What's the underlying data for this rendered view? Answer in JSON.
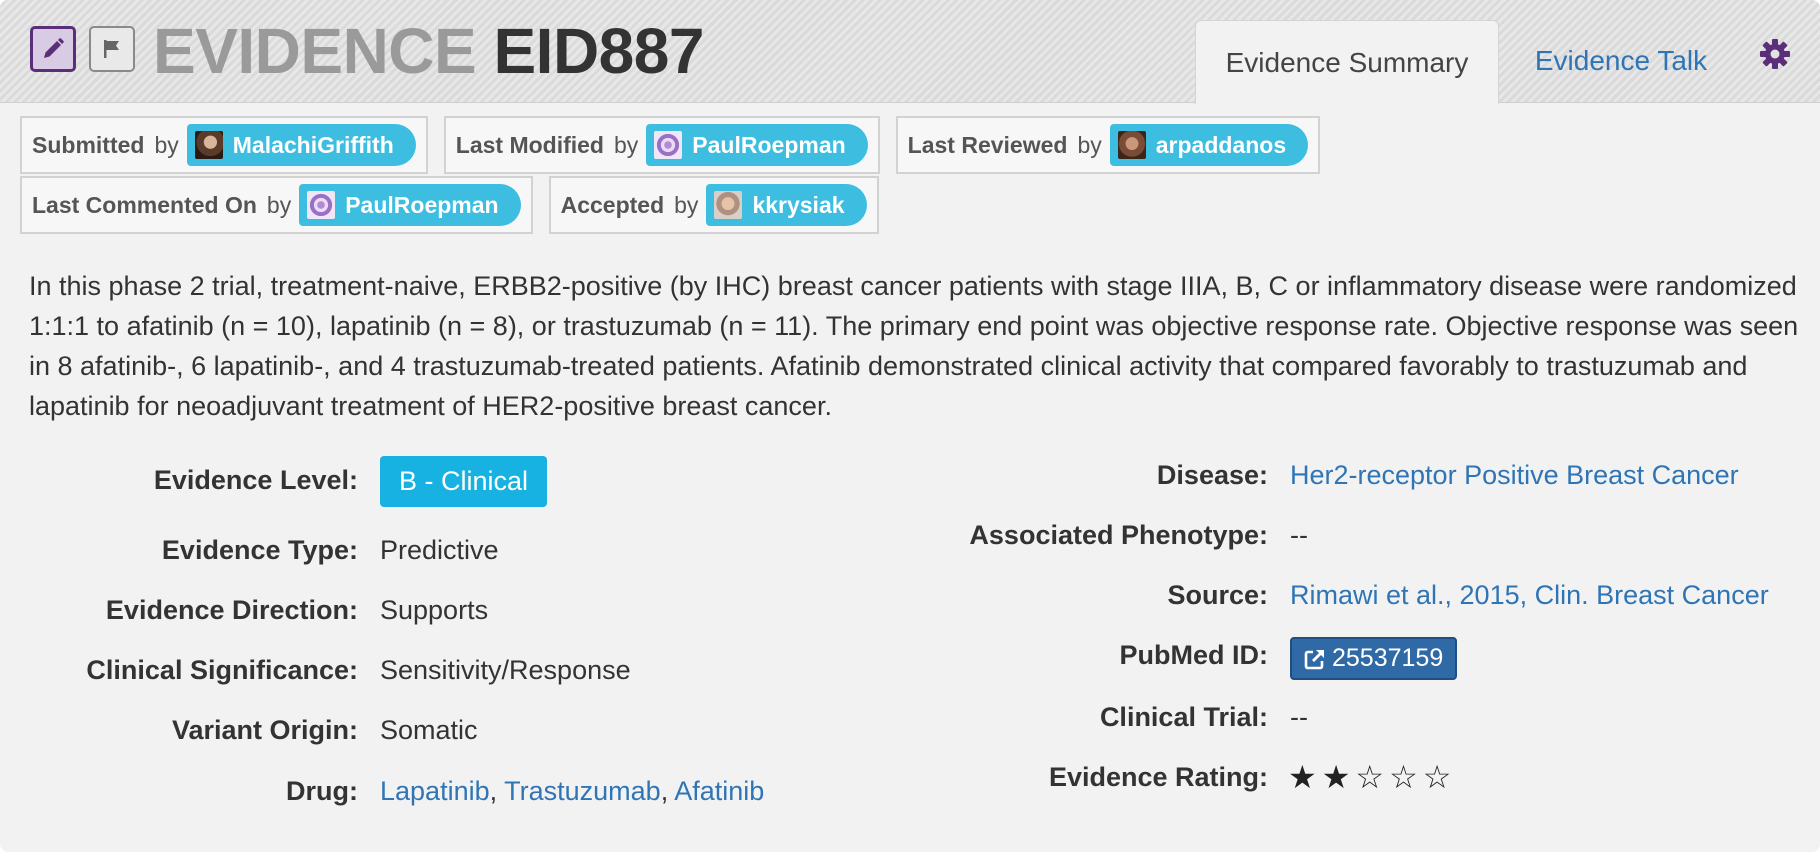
{
  "header": {
    "title_prefix": "EVIDENCE",
    "title_id": "EID887",
    "tabs": [
      {
        "label": "Evidence Summary",
        "active": true
      },
      {
        "label": "Evidence Talk",
        "active": false
      }
    ]
  },
  "meta": {
    "by": "by",
    "submitted": {
      "label": "Submitted",
      "user": "MalachiGriffith"
    },
    "last_modified": {
      "label": "Last Modified",
      "user": "PaulRoepman"
    },
    "last_reviewed": {
      "label": "Last Reviewed",
      "user": "arpaddanos"
    },
    "last_commented": {
      "label": "Last Commented On",
      "user": "PaulRoepman"
    },
    "accepted": {
      "label": "Accepted",
      "user": "kkrysiak"
    }
  },
  "description": "In this phase 2 trial, treatment-naive, ERBB2-positive (by IHC) breast cancer patients with stage IIIA, B, C or inflammatory disease were randomized 1:1:1 to afatinib (n = 10), lapatinib (n = 8), or trastuzumab (n = 11). The primary end point was objective response rate. Objective response was seen in 8 afatinib-, 6 lapatinib-, and 4 trastuzumab-treated patients. Afatinib demonstrated clinical activity that compared favorably to trastuzumab and lapatinib for neoadjuvant treatment of HER2-positive breast cancer.",
  "left_fields": {
    "evidence_level": {
      "label": "Evidence Level:",
      "value": "B - Clinical"
    },
    "evidence_type": {
      "label": "Evidence Type:",
      "value": "Predictive"
    },
    "evidence_direction": {
      "label": "Evidence Direction:",
      "value": "Supports"
    },
    "clinical_significance": {
      "label": "Clinical Significance:",
      "value": "Sensitivity/Response"
    },
    "variant_origin": {
      "label": "Variant Origin:",
      "value": "Somatic"
    },
    "drug": {
      "label": "Drug:",
      "values": [
        "Lapatinib",
        "Trastuzumab",
        "Afatinib"
      ],
      "separator": ","
    }
  },
  "right_fields": {
    "disease": {
      "label": "Disease:",
      "value": "Her2-receptor Positive Breast Cancer"
    },
    "associated_phenotype": {
      "label": "Associated Phenotype:",
      "value": "--"
    },
    "source": {
      "label": "Source:",
      "value": "Rimawi et al., 2015, Clin. Breast Cancer"
    },
    "pubmed_id": {
      "label": "PubMed ID:",
      "value": "25537159"
    },
    "clinical_trial": {
      "label": "Clinical Trial:",
      "value": "--"
    },
    "evidence_rating": {
      "label": "Evidence Rating:",
      "rating": 2,
      "max": 5,
      "stars_text": "★★☆☆☆"
    }
  },
  "colors": {
    "accent_purple": "#5a2e78",
    "user_pill": "#3dbde0",
    "link": "#2f75b5",
    "level_badge": "#17b2e2",
    "pubmed_button": "#2f6aa7"
  },
  "icons": {
    "edit": "pencil-icon",
    "flag": "flag-icon",
    "settings": "gear-icon",
    "external_link": "external-link-icon"
  }
}
